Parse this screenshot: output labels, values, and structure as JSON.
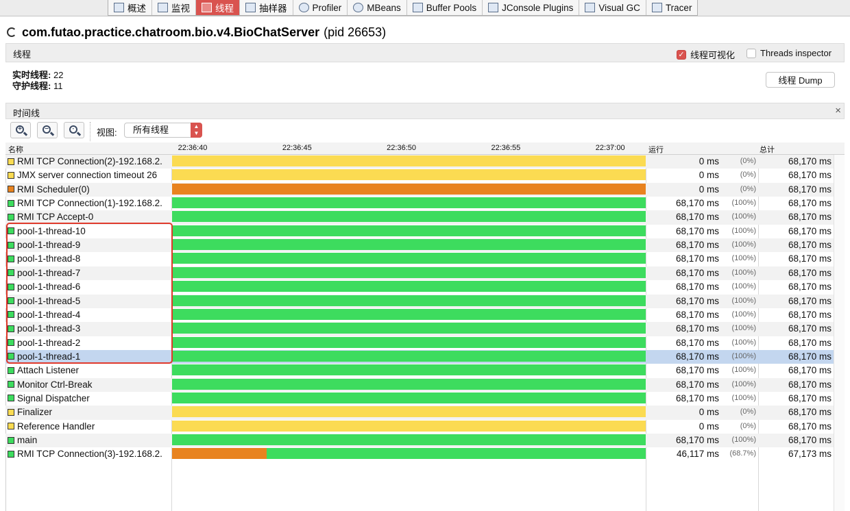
{
  "tabs": [
    {
      "label": "概述",
      "icon": "overview-icon",
      "active": false
    },
    {
      "label": "监视",
      "icon": "monitor-icon",
      "active": false
    },
    {
      "label": "线程",
      "icon": "threads-icon",
      "active": true
    },
    {
      "label": "抽样器",
      "icon": "sampler-icon",
      "active": false
    },
    {
      "label": "Profiler",
      "icon": "profiler-icon",
      "active": false
    },
    {
      "label": "MBeans",
      "icon": "mbeans-icon",
      "active": false
    },
    {
      "label": "Buffer Pools",
      "icon": "buffer-pools-icon",
      "active": false
    },
    {
      "label": "JConsole Plugins",
      "icon": "jconsole-plugins-icon",
      "active": false
    },
    {
      "label": "Visual GC",
      "icon": "visual-gc-icon",
      "active": false
    },
    {
      "label": "Tracer",
      "icon": "tracer-icon",
      "active": false
    }
  ],
  "header": {
    "app_name": "com.futao.practice.chatroom.bio.v4.BioChatServer",
    "pid": "(pid 26653)"
  },
  "threads_section": {
    "title": "线程",
    "visualize_label": "线程可视化",
    "visualize_checked": true,
    "inspector_label": "Threads inspector",
    "inspector_checked": false
  },
  "stats": {
    "live_label": "实时线程:",
    "live_value": "22",
    "daemon_label": "守护线程:",
    "daemon_value": "11"
  },
  "dump_button": "线程 Dump",
  "timeline": {
    "title": "时间线",
    "close": "×",
    "view_label": "视图:",
    "view_value": "所有线程",
    "col_name": "名称",
    "col_run": "运行",
    "col_total": "总计",
    "ticks": [
      "22:36:40",
      "22:36:45",
      "22:36:50",
      "22:36:55",
      "22:37:00"
    ]
  },
  "colors": {
    "running": "#3ddc5e",
    "waiting": "#fbdb52",
    "timed_waiting": "#e8831f",
    "highlight": "#e0392b",
    "accent": "#d9534f"
  },
  "threads": [
    {
      "name": "RMI TCP Connection(2)-192.168.2.",
      "state": "waiting",
      "run": "0 ms",
      "pct": "(0%)",
      "total": "68,170 ms",
      "segments": [
        {
          "state": "waiting",
          "frac": 1
        }
      ]
    },
    {
      "name": "JMX server connection timeout 26",
      "state": "waiting",
      "run": "0 ms",
      "pct": "(0%)",
      "total": "68,170 ms",
      "segments": [
        {
          "state": "waiting",
          "frac": 1
        }
      ]
    },
    {
      "name": "RMI Scheduler(0)",
      "state": "timed_waiting",
      "run": "0 ms",
      "pct": "(0%)",
      "total": "68,170 ms",
      "segments": [
        {
          "state": "timed_waiting",
          "frac": 1
        }
      ]
    },
    {
      "name": "RMI TCP Connection(1)-192.168.2.",
      "state": "running",
      "run": "68,170 ms",
      "pct": "(100%)",
      "total": "68,170 ms",
      "segments": [
        {
          "state": "running",
          "frac": 1
        }
      ]
    },
    {
      "name": "RMI TCP Accept-0",
      "state": "running",
      "run": "68,170 ms",
      "pct": "(100%)",
      "total": "68,170 ms",
      "segments": [
        {
          "state": "running",
          "frac": 1
        }
      ]
    },
    {
      "name": "pool-1-thread-10",
      "state": "running",
      "run": "68,170 ms",
      "pct": "(100%)",
      "total": "68,170 ms",
      "segments": [
        {
          "state": "running",
          "frac": 1
        }
      ]
    },
    {
      "name": "pool-1-thread-9",
      "state": "running",
      "run": "68,170 ms",
      "pct": "(100%)",
      "total": "68,170 ms",
      "segments": [
        {
          "state": "running",
          "frac": 1
        }
      ]
    },
    {
      "name": "pool-1-thread-8",
      "state": "running",
      "run": "68,170 ms",
      "pct": "(100%)",
      "total": "68,170 ms",
      "segments": [
        {
          "state": "running",
          "frac": 1
        }
      ]
    },
    {
      "name": "pool-1-thread-7",
      "state": "running",
      "run": "68,170 ms",
      "pct": "(100%)",
      "total": "68,170 ms",
      "segments": [
        {
          "state": "running",
          "frac": 1
        }
      ]
    },
    {
      "name": "pool-1-thread-6",
      "state": "running",
      "run": "68,170 ms",
      "pct": "(100%)",
      "total": "68,170 ms",
      "segments": [
        {
          "state": "running",
          "frac": 1
        }
      ]
    },
    {
      "name": "pool-1-thread-5",
      "state": "running",
      "run": "68,170 ms",
      "pct": "(100%)",
      "total": "68,170 ms",
      "segments": [
        {
          "state": "running",
          "frac": 1
        }
      ]
    },
    {
      "name": "pool-1-thread-4",
      "state": "running",
      "run": "68,170 ms",
      "pct": "(100%)",
      "total": "68,170 ms",
      "segments": [
        {
          "state": "running",
          "frac": 1
        }
      ]
    },
    {
      "name": "pool-1-thread-3",
      "state": "running",
      "run": "68,170 ms",
      "pct": "(100%)",
      "total": "68,170 ms",
      "segments": [
        {
          "state": "running",
          "frac": 1
        }
      ]
    },
    {
      "name": "pool-1-thread-2",
      "state": "running",
      "run": "68,170 ms",
      "pct": "(100%)",
      "total": "68,170 ms",
      "segments": [
        {
          "state": "running",
          "frac": 1
        }
      ]
    },
    {
      "name": "pool-1-thread-1",
      "state": "running",
      "run": "68,170 ms",
      "pct": "(100%)",
      "total": "68,170 ms",
      "selected": true,
      "segments": [
        {
          "state": "running",
          "frac": 1
        }
      ]
    },
    {
      "name": "Attach Listener",
      "state": "running",
      "run": "68,170 ms",
      "pct": "(100%)",
      "total": "68,170 ms",
      "segments": [
        {
          "state": "running",
          "frac": 1
        }
      ]
    },
    {
      "name": "Monitor Ctrl-Break",
      "state": "running",
      "run": "68,170 ms",
      "pct": "(100%)",
      "total": "68,170 ms",
      "segments": [
        {
          "state": "running",
          "frac": 1
        }
      ]
    },
    {
      "name": "Signal Dispatcher",
      "state": "running",
      "run": "68,170 ms",
      "pct": "(100%)",
      "total": "68,170 ms",
      "segments": [
        {
          "state": "running",
          "frac": 1
        }
      ]
    },
    {
      "name": "Finalizer",
      "state": "waiting",
      "run": "0 ms",
      "pct": "(0%)",
      "total": "68,170 ms",
      "segments": [
        {
          "state": "waiting",
          "frac": 1
        }
      ]
    },
    {
      "name": "Reference Handler",
      "state": "waiting",
      "run": "0 ms",
      "pct": "(0%)",
      "total": "68,170 ms",
      "segments": [
        {
          "state": "waiting",
          "frac": 1
        }
      ]
    },
    {
      "name": "main",
      "state": "running",
      "run": "68,170 ms",
      "pct": "(100%)",
      "total": "68,170 ms",
      "segments": [
        {
          "state": "running",
          "frac": 1
        }
      ]
    },
    {
      "name": "RMI TCP Connection(3)-192.168.2.",
      "state": "running",
      "run": "46,117 ms",
      "pct": "(68.7%)",
      "total": "67,173 ms",
      "segments": [
        {
          "state": "timed_waiting",
          "frac": 0.2
        },
        {
          "state": "running",
          "frac": 0.8
        }
      ]
    }
  ]
}
